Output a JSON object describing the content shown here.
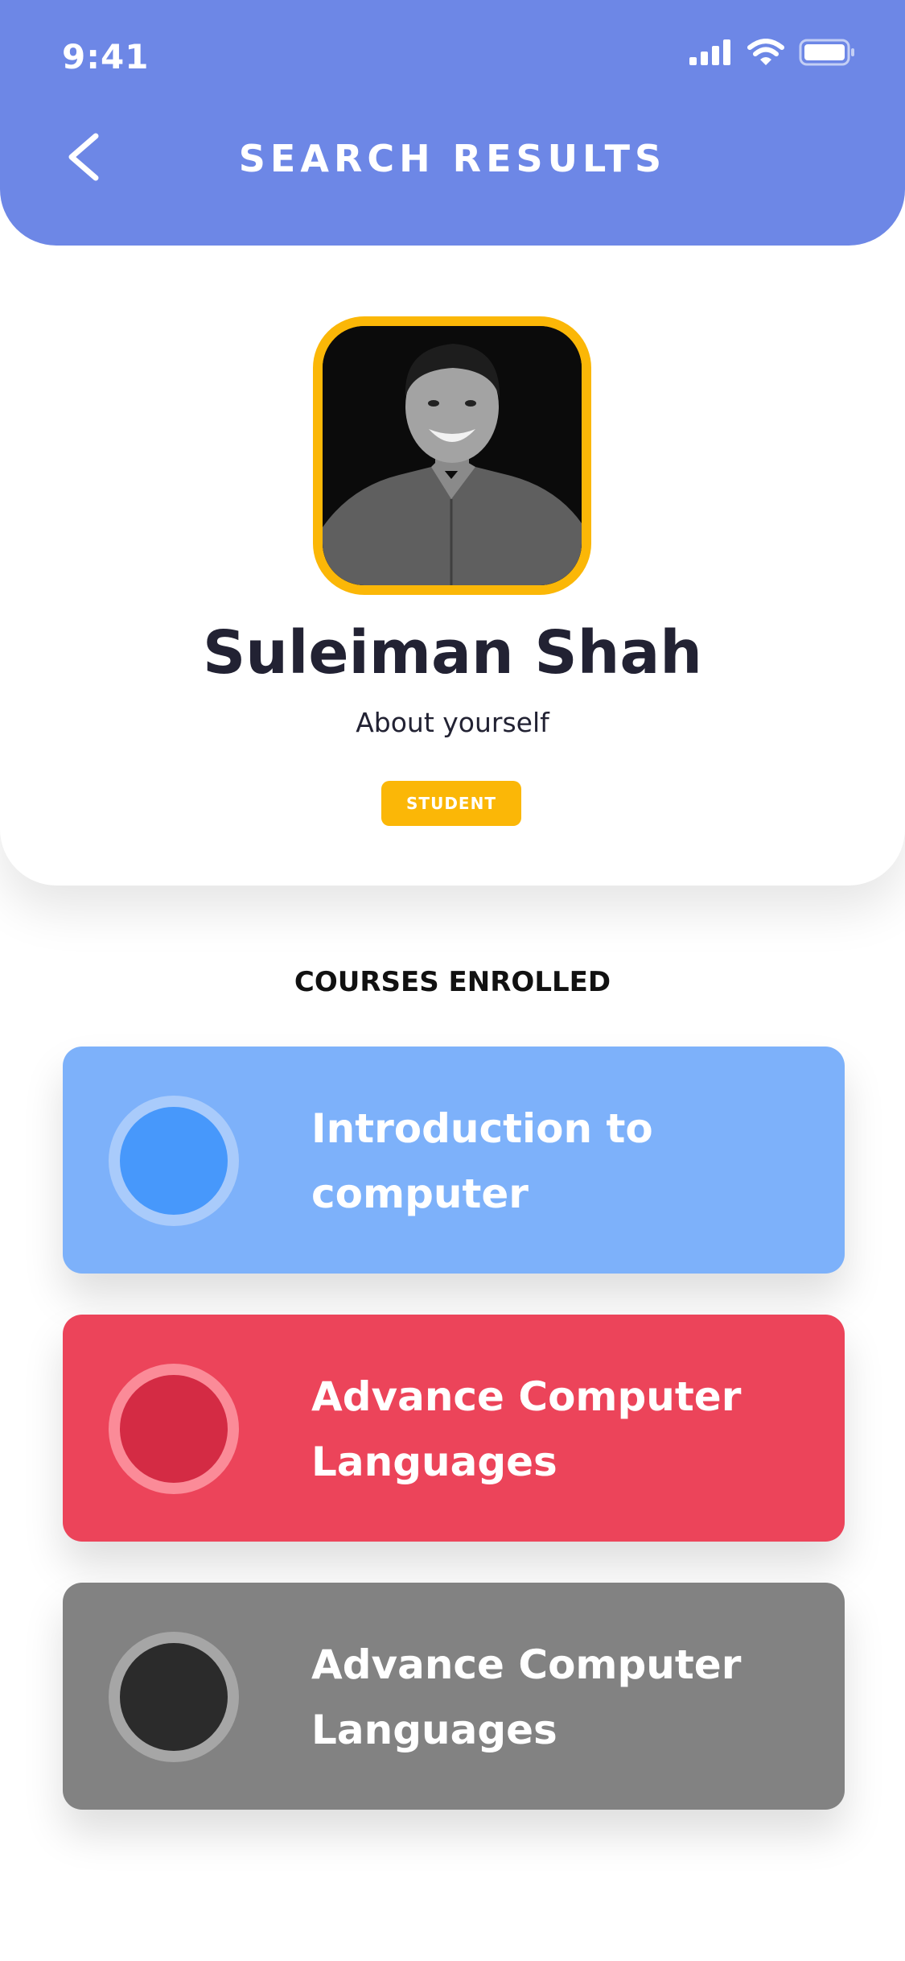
{
  "status_bar": {
    "time": "9:41"
  },
  "header": {
    "title": "SEARCH RESULTS"
  },
  "profile": {
    "name": "Suleiman Shah",
    "about": "About yourself",
    "role_badge": "STUDENT"
  },
  "courses": {
    "section_title": "COURSES ENROLLED",
    "items": [
      {
        "title": "Introduction to computer",
        "card_color": "#7db1fa",
        "icon_fill": "#4798fb",
        "icon_ring": "#a9cbfb"
      },
      {
        "title": "Advance Computer Languages",
        "card_color": "#ec445a",
        "icon_fill": "#d42b44",
        "icon_ring": "#fb8b98"
      },
      {
        "title": "Advance Computer Languages",
        "card_color": "#828282",
        "icon_fill": "#2b2b2b",
        "icon_ring": "#a6a6a6"
      }
    ]
  },
  "colors": {
    "header_bg": "#6d87e6",
    "accent": "#fbb707",
    "text_dark": "#222233"
  },
  "icons": {
    "back": "chevron-left-icon",
    "signal": "cellular-signal-icon",
    "wifi": "wifi-icon",
    "battery": "battery-icon"
  }
}
